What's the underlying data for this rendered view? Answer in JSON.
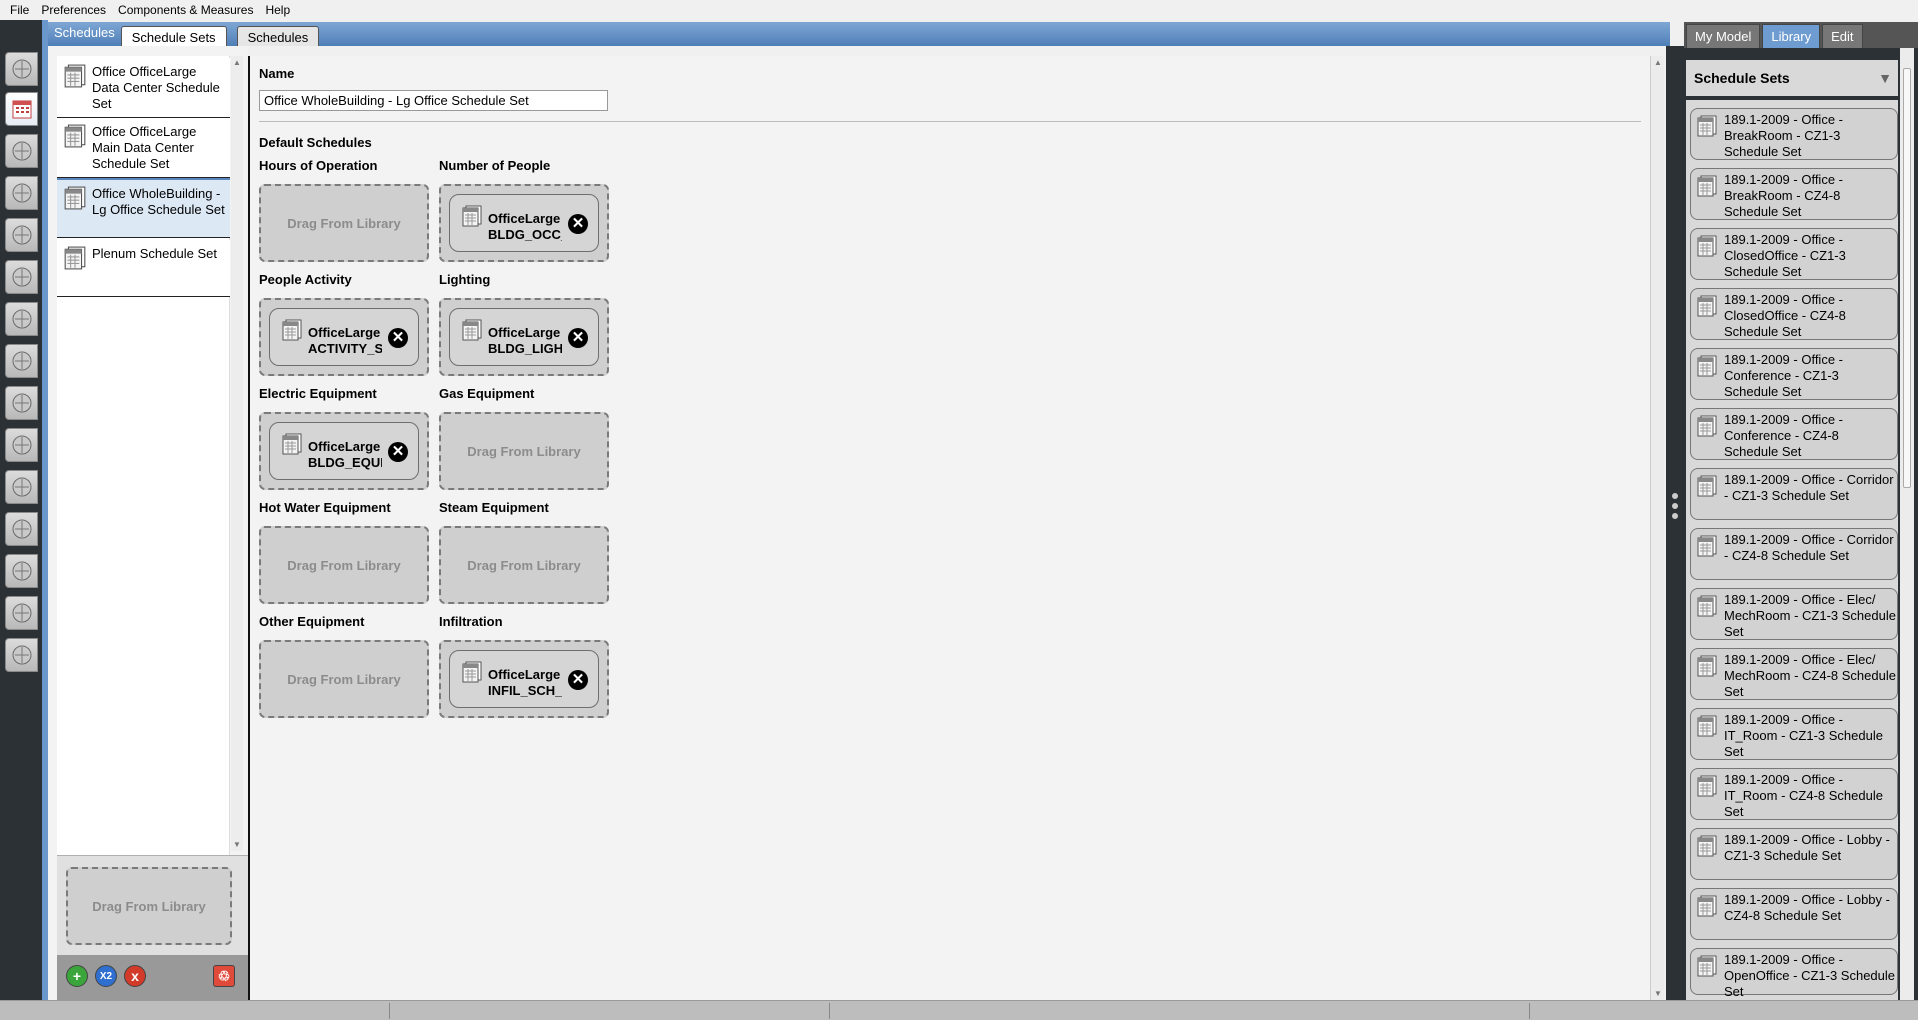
{
  "menu": [
    "File",
    "Preferences",
    "Components & Measures",
    "Help"
  ],
  "main_tabs": {
    "section_label": "Schedules",
    "tabs": [
      {
        "label": "Schedule Sets",
        "active": true
      },
      {
        "label": "Schedules",
        "active": false
      }
    ]
  },
  "left_nav_icons": [
    "site-icon",
    "schedules-icon",
    "constructions-icon",
    "loads-icon",
    "space-types-icon",
    "geometry-icon",
    "facility-icon",
    "spaces-icon",
    "thermal-zones-icon",
    "hvac-icon",
    "output-variables-icon",
    "simulation-settings-icon",
    "scripts-icon",
    "run-icon",
    "results-icon"
  ],
  "sidebar": {
    "items": [
      {
        "label": "Office OfficeLarge Data Center Schedule Set",
        "selected": false
      },
      {
        "label": "Office OfficeLarge Main Data Center Schedule Set",
        "selected": false
      },
      {
        "label": "Office WholeBuilding - Lg Office Schedule Set",
        "selected": true
      },
      {
        "label": "Plenum Schedule Set",
        "selected": false
      }
    ],
    "drop_label": "Drag From Library",
    "buttons": {
      "add": "+",
      "copy": "X2",
      "remove": "x",
      "purge": "♲"
    }
  },
  "content": {
    "name_label": "Name",
    "name_value": "Office WholeBuilding - Lg Office Schedule Set",
    "default_schedules_label": "Default Schedules",
    "drop_placeholder": "Drag From Library",
    "slots": [
      {
        "label": "Hours of Operation",
        "filled": false
      },
      {
        "label": "Number of People",
        "filled": true,
        "line1": "OfficeLarge",
        "line2": "BLDG_OCC_S"
      },
      {
        "label": "People Activity",
        "filled": true,
        "line1": "OfficeLarge",
        "line2": "ACTIVITY_SC"
      },
      {
        "label": "Lighting",
        "filled": true,
        "line1": "OfficeLarge",
        "line2": "BLDG_LIGHT_"
      },
      {
        "label": "Electric Equipment",
        "filled": true,
        "line1": "OfficeLarge",
        "line2": "BLDG_EQUIP_"
      },
      {
        "label": "Gas Equipment",
        "filled": false
      },
      {
        "label": "Hot Water Equipment",
        "filled": false
      },
      {
        "label": "Steam Equipment",
        "filled": false
      },
      {
        "label": "Other Equipment",
        "filled": false
      },
      {
        "label": "Infiltration",
        "filled": true,
        "line1": "OfficeLarge",
        "line2": "INFIL_SCH_P"
      }
    ]
  },
  "right_panel": {
    "tabs": [
      {
        "label": "My Model",
        "active": false
      },
      {
        "label": "Library",
        "active": true
      },
      {
        "label": "Edit",
        "active": false
      }
    ],
    "header": "Schedule Sets",
    "items": [
      "189.1-2009 - Office - BreakRoom - CZ1-3 Schedule Set",
      "189.1-2009 - Office - BreakRoom - CZ4-8 Schedule Set",
      "189.1-2009 - Office - ClosedOffice - CZ1-3 Schedule Set",
      "189.1-2009 - Office - ClosedOffice - CZ4-8 Schedule Set",
      "189.1-2009 - Office - Conference - CZ1-3 Schedule Set",
      "189.1-2009 - Office - Conference - CZ4-8 Schedule Set",
      "189.1-2009 - Office - Corridor - CZ1-3 Schedule Set",
      "189.1-2009 - Office - Corridor - CZ4-8 Schedule Set",
      "189.1-2009 - Office - Elec/ MechRoom - CZ1-3 Schedule Set",
      "189.1-2009 - Office - Elec/ MechRoom - CZ4-8 Schedule Set",
      "189.1-2009 - Office - IT_Room - CZ1-3 Schedule Set",
      "189.1-2009 - Office - IT_Room - CZ4-8 Schedule Set",
      "189.1-2009 - Office - Lobby - CZ1-3 Schedule Set",
      "189.1-2009 - Office - Lobby - CZ4-8 Schedule Set",
      "189.1-2009 - Office - OpenOffice - CZ1-3 Schedule Set"
    ]
  },
  "colors": {
    "accent_blue": "#6a98cc",
    "dark_panel": "#2c3135",
    "drop_fill": "#cfcfcf",
    "add_green": "#3aa53a",
    "copy_blue": "#2f6fd0",
    "remove_red": "#d23a2a",
    "purge_red": "#e04a3a"
  }
}
